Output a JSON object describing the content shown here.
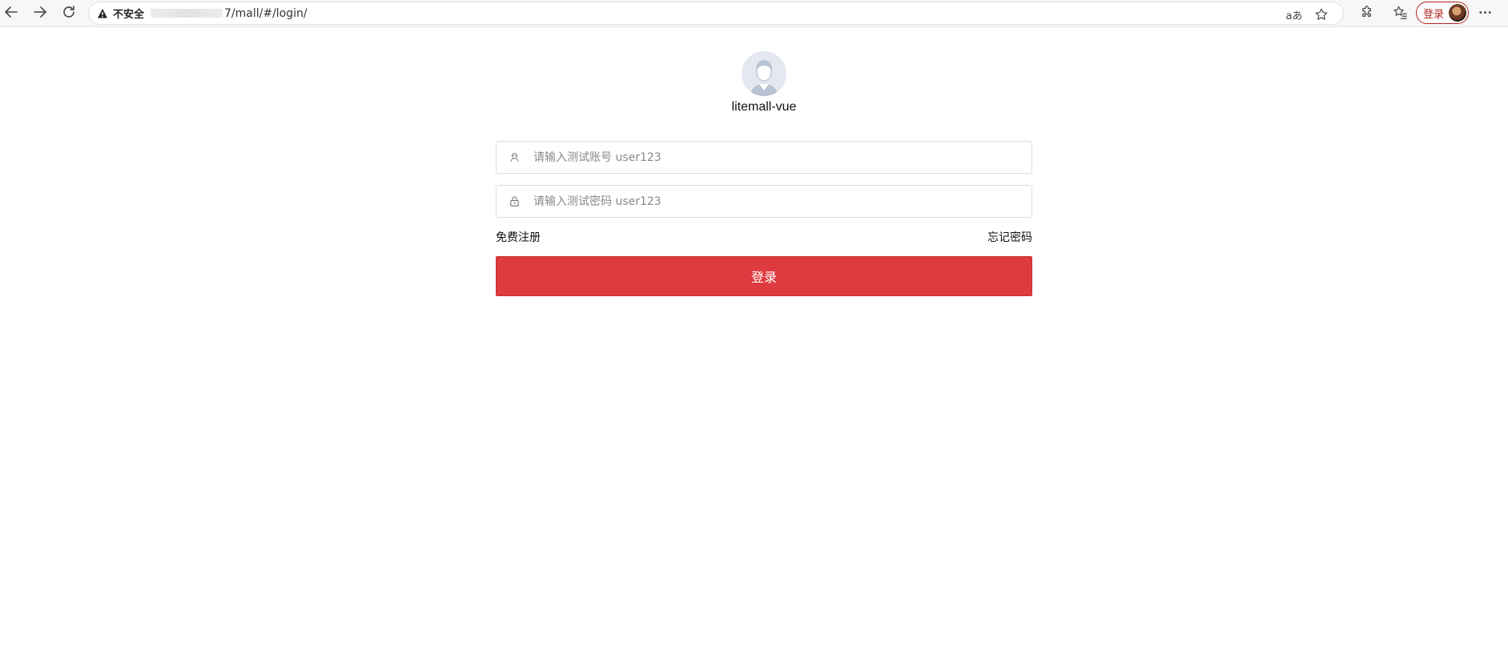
{
  "browser": {
    "insecure_label": "不安全",
    "url": "7/mall/#/login/",
    "profile_label": "登录",
    "reader_icon_text": "aあ",
    "accent_color": "#b3261e"
  },
  "login": {
    "site_name": "litemall-vue",
    "username_placeholder": "请输入测试账号 user123",
    "password_placeholder": "请输入测试密码 user123",
    "register_link": "免费注册",
    "forgot_link": "忘记密码",
    "submit_label": "登录",
    "button_color": "#de3b40"
  },
  "icons": {
    "back": "arrow-left-icon",
    "forward": "arrow-right-icon",
    "refresh": "refresh-icon",
    "warning": "warning-triangle-icon",
    "read_aloud": "read-aloud-icon",
    "favorite": "star-icon",
    "extensions": "puzzle-icon",
    "favorites_list": "favorites-list-icon",
    "more": "more-icon",
    "user_field": "user-icon",
    "password_field": "lock-icon",
    "logo": "avatar-icon"
  }
}
